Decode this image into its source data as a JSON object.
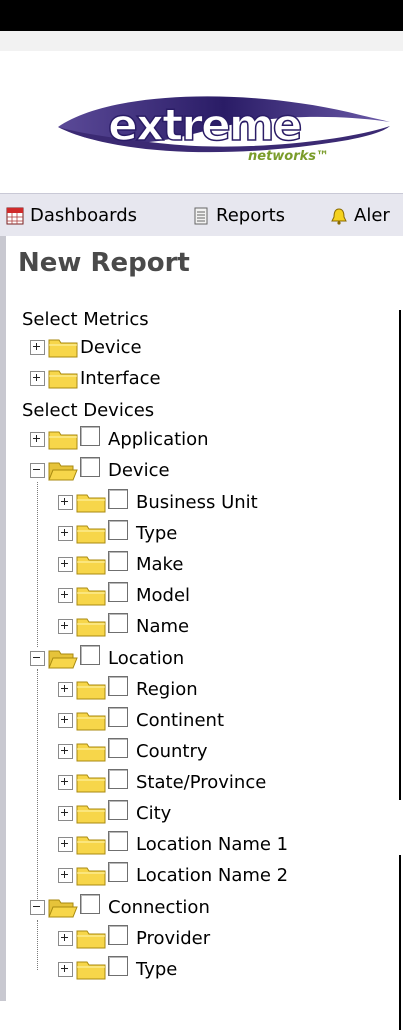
{
  "logo": {
    "wordmark": "extreme",
    "subtext": "networks™"
  },
  "nav": {
    "items": [
      {
        "label": "Dashboards",
        "icon": "calendar-icon"
      },
      {
        "label": "Reports",
        "icon": "document-icon"
      },
      {
        "label": "Aler",
        "icon": "bell-icon"
      }
    ]
  },
  "page": {
    "title": "New Report"
  },
  "metrics": {
    "heading": "Select Metrics",
    "items": [
      "Device",
      "Interface"
    ]
  },
  "devices": {
    "heading": "Select Devices",
    "application": "Application",
    "device": {
      "label": "Device",
      "children": [
        "Business Unit",
        "Type",
        "Make",
        "Model",
        "Name"
      ]
    },
    "location": {
      "label": "Location",
      "children": [
        "Region",
        "Continent",
        "Country",
        "State/Province",
        "City",
        "Location Name 1",
        "Location Name 2"
      ]
    },
    "connection": {
      "label": "Connection",
      "children": [
        "Provider",
        "Type"
      ]
    }
  },
  "colors": {
    "brand_purple": "#3b2a73",
    "folder_yellow": "#f7d64a",
    "nav_bg": "#e7e7ef"
  }
}
